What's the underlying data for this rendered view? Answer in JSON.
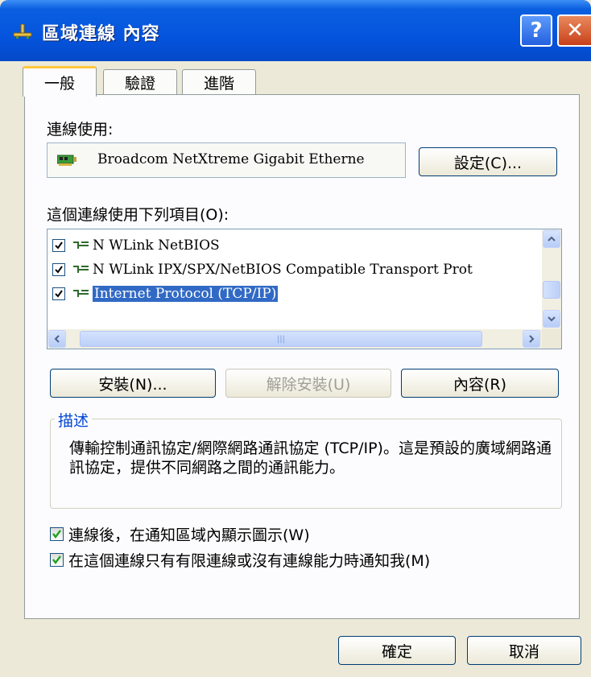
{
  "window": {
    "title": "區域連線 內容",
    "help_glyph": "?",
    "close_glyph": "✕",
    "colors": {
      "titlebar": "#0554dd",
      "face": "#ece9d8",
      "accent_tab": "#ffc83c",
      "selection": "#316ac5"
    }
  },
  "tabs": [
    {
      "label": "一般",
      "active": true
    },
    {
      "label": "驗證",
      "active": false
    },
    {
      "label": "進階",
      "active": false
    }
  ],
  "connect_using": {
    "label": "連線使用:",
    "adapter": "Broadcom NetXtreme Gigabit Etherne",
    "adapter_icon": "network-card-icon",
    "configure_button": "設定(C)..."
  },
  "components": {
    "label": "這個連線使用下列項目(O):",
    "items": [
      {
        "label": "N WLink NetBIOS",
        "checked": true,
        "selected": false
      },
      {
        "label": "N WLink IPX/SPX/NetBIOS Compatible Transport Prot",
        "checked": true,
        "selected": false
      },
      {
        "label": "Internet Protocol (TCP/IP)",
        "checked": true,
        "selected": true
      }
    ]
  },
  "buttons": {
    "install": "安裝(N)...",
    "uninstall": "解除安裝(U)",
    "properties": "內容(R)",
    "ok": "確定",
    "cancel": "取消"
  },
  "description": {
    "title": "描述",
    "text": "傳輸控制通訊協定/網際網路通訊協定 (TCP/IP)。這是預設的廣域網路通訊協定，提供不同網路之間的通訊能力。"
  },
  "options": [
    {
      "label": "連線後，在通知區域內顯示圖示(W)",
      "checked": true
    },
    {
      "label": "在這個連線只有有限連線或沒有連線能力時通知我(M)",
      "checked": true
    }
  ]
}
